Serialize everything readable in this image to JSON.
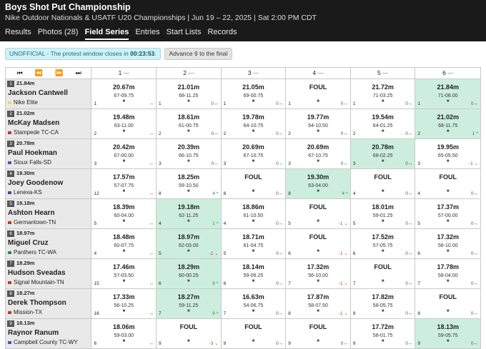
{
  "header": {
    "title": "Boys Shot Put Championship",
    "subtitle": "Nike Outdoor Nationals & USATF U20 Championships | Jun 19 – 22, 2025 | Sat 2:00 PM CDT",
    "tabs": [
      "Results",
      "Photos (28)",
      "Field Series",
      "Entries",
      "Start Lists",
      "Records"
    ],
    "active_tab": "Field Series"
  },
  "status": {
    "prefix": "UNOFFICIAL  -  The protest window closes in",
    "countdown": "00:23:53",
    "suffix": ".",
    "advance_label": "Advance 9 to the final"
  },
  "nav": {
    "first": "⏮",
    "prev": "⏪",
    "next": "⏩",
    "last": "⏭"
  },
  "attempt_headers": [
    "1",
    "2",
    "3",
    "4",
    "5",
    "6"
  ],
  "colors": {
    "highlight": "#cdeede",
    "header_bg": "#1a1a1a",
    "wind_up": "#2a8a56",
    "wind_down": "#c0392b"
  },
  "athletes": [
    {
      "place": "1",
      "best": "21.84m",
      "name": "Jackson Cantwell",
      "team": "Nike Elite",
      "flag_color": "#f5d36a",
      "attempts": [
        {
          "mark": "20.67m",
          "imperial": "67-09.75",
          "order": "1",
          "wind": "↔",
          "hi": false
        },
        {
          "mark": "21.01m",
          "imperial": "68-11.25",
          "order": "1",
          "wind": "0↔",
          "hi": false
        },
        {
          "mark": "21.05m",
          "imperial": "69-00.75",
          "order": "1",
          "wind": "0↔",
          "hi": false
        },
        {
          "mark": "FOUL",
          "imperial": "",
          "order": "1",
          "wind": "0↔",
          "hi": false
        },
        {
          "mark": "21.72m",
          "imperial": "71-03.25",
          "order": "1",
          "wind": "0↔",
          "hi": false
        },
        {
          "mark": "21.84m",
          "imperial": "71-08.00",
          "order": "1",
          "wind": "0↔",
          "hi": true
        }
      ]
    },
    {
      "place": "2",
      "best": "21.02m",
      "name": "McKay Madsen",
      "team": "Stampede TC-CA",
      "flag_color": "#c0392b",
      "attempts": [
        {
          "mark": "19.48m",
          "imperial": "63-11.00",
          "order": "2",
          "wind": "↔",
          "hi": false
        },
        {
          "mark": "18.61m",
          "imperial": "61-00.75",
          "order": "2",
          "wind": "0↔",
          "hi": false
        },
        {
          "mark": "19.78m",
          "imperial": "64-10.75",
          "order": "2",
          "wind": "0↔",
          "hi": false
        },
        {
          "mark": "19.77m",
          "imperial": "64-10.50",
          "order": "2",
          "wind": "0↔",
          "hi": false
        },
        {
          "mark": "19.54m",
          "imperial": "64-01.25",
          "order": "2",
          "wind": "0↔",
          "hi": false
        },
        {
          "mark": "21.02m",
          "imperial": "68-11.75",
          "order": "2",
          "wind": "1 ^",
          "hi": true
        }
      ]
    },
    {
      "place": "3",
      "best": "20.78m",
      "name": "Paul Hoekman",
      "team": "Sioux Falls-SD",
      "flag_color": "#3b5bb5",
      "attempts": [
        {
          "mark": "20.42m",
          "imperial": "67-00.00",
          "order": "3",
          "wind": "↔",
          "hi": false
        },
        {
          "mark": "20.39m",
          "imperial": "66-10.75",
          "order": "3",
          "wind": "0↔",
          "hi": false
        },
        {
          "mark": "20.69m",
          "imperial": "67-10.75",
          "order": "3",
          "wind": "0↔",
          "hi": false
        },
        {
          "mark": "20.69m",
          "imperial": "67-10.75",
          "order": "3",
          "wind": "0↔",
          "hi": false
        },
        {
          "mark": "20.78m",
          "imperial": "68-02.25",
          "order": "3",
          "wind": "0↔",
          "hi": true
        },
        {
          "mark": "19.95m",
          "imperial": "65-05.50",
          "order": "3",
          "wind": "-1 ⌄",
          "hi": false
        }
      ]
    },
    {
      "place": "4",
      "best": "19.30m",
      "name": "Joey Goodenow",
      "team": "Lenexa-KS",
      "flag_color": "#5a3f9b",
      "attempts": [
        {
          "mark": "17.57m",
          "imperial": "57-07.75",
          "order": "12",
          "wind": "↔",
          "hi": false
        },
        {
          "mark": "18.25m",
          "imperial": "59-10.50",
          "order": "8",
          "wind": "4 ^",
          "hi": false
        },
        {
          "mark": "FOUL",
          "imperial": "",
          "order": "8",
          "wind": "0↔",
          "hi": false
        },
        {
          "mark": "19.30m",
          "imperial": "63-04.00",
          "order": "8",
          "wind": "4 ^",
          "hi": true
        },
        {
          "mark": "FOUL",
          "imperial": "",
          "order": "4",
          "wind": "0↔",
          "hi": false
        },
        {
          "mark": "FOUL",
          "imperial": "",
          "order": "4",
          "wind": "0↔",
          "hi": false
        }
      ]
    },
    {
      "place": "5",
      "best": "19.18m",
      "name": "Ashton Hearn",
      "team": "Germantown-TN",
      "flag_color": "#c0392b",
      "attempts": [
        {
          "mark": "18.39m",
          "imperial": "60-04.00",
          "order": "5",
          "wind": "↔",
          "hi": false
        },
        {
          "mark": "19.18m",
          "imperial": "62-11.25",
          "order": "4",
          "wind": "1 ^",
          "hi": true
        },
        {
          "mark": "18.86m",
          "imperial": "61-10.50",
          "order": "4",
          "wind": "0↔",
          "hi": false
        },
        {
          "mark": "FOUL",
          "imperial": "",
          "order": "5",
          "wind": "-1 ⌄",
          "hi": false
        },
        {
          "mark": "18.01m",
          "imperial": "59-01.25",
          "order": "5",
          "wind": "0↔",
          "hi": false
        },
        {
          "mark": "17.37m",
          "imperial": "57-00.00",
          "order": "5",
          "wind": "0↔",
          "hi": false
        }
      ]
    },
    {
      "place": "6",
      "best": "18.97m",
      "name": "Miguel Cruz",
      "team": "Panthers TC-WA",
      "flag_color": "#2a8a56",
      "attempts": [
        {
          "mark": "18.48m",
          "imperial": "60-07.75",
          "order": "4",
          "wind": "↔",
          "hi": false
        },
        {
          "mark": "18.97m",
          "imperial": "62-03.00",
          "order": "5",
          "wind": "-1 ⌄",
          "hi": true
        },
        {
          "mark": "18.71m",
          "imperial": "61-04.75",
          "order": "5",
          "wind": "0↔",
          "hi": false
        },
        {
          "mark": "FOUL",
          "imperial": "",
          "order": "6",
          "wind": "-1 ⌄",
          "hi": false
        },
        {
          "mark": "17.52m",
          "imperial": "57-05.75",
          "order": "6",
          "wind": "0↔",
          "hi": false
        },
        {
          "mark": "17.32m",
          "imperial": "56-10.00",
          "order": "6",
          "wind": "0↔",
          "hi": false
        }
      ]
    },
    {
      "place": "7",
      "best": "18.29m",
      "name": "Hudson Sveadas",
      "team": "Signal Mountain-TN",
      "flag_color": "#c0392b",
      "attempts": [
        {
          "mark": "17.46m",
          "imperial": "57-03.50",
          "order": "15",
          "wind": "↔",
          "hi": false
        },
        {
          "mark": "18.29m",
          "imperial": "60-00.25",
          "order": "6",
          "wind": "9 ^",
          "hi": true
        },
        {
          "mark": "18.14m",
          "imperial": "59-06.25",
          "order": "6",
          "wind": "0↔",
          "hi": false
        },
        {
          "mark": "17.32m",
          "imperial": "56-10.00",
          "order": "7",
          "wind": "-1 ⌄",
          "hi": false
        },
        {
          "mark": "FOUL",
          "imperial": "",
          "order": "7",
          "wind": "0↔",
          "hi": false
        },
        {
          "mark": "17.78m",
          "imperial": "58-04.00",
          "order": "7",
          "wind": "0↔",
          "hi": false
        }
      ]
    },
    {
      "place": "8",
      "best": "18.27m",
      "name": "Derek Thompson",
      "team": "Mission-TX",
      "flag_color": "#c0392b",
      "attempts": [
        {
          "mark": "17.33m",
          "imperial": "56-10.25",
          "order": "16",
          "wind": "↔",
          "hi": false
        },
        {
          "mark": "18.27m",
          "imperial": "59-11.25",
          "order": "7",
          "wind": "9 ^",
          "hi": true
        },
        {
          "mark": "16.63m",
          "imperial": "54-06.75",
          "order": "7",
          "wind": "0↔",
          "hi": false
        },
        {
          "mark": "17.87m",
          "imperial": "58-07.50",
          "order": "8",
          "wind": "-1 ⌄",
          "hi": false
        },
        {
          "mark": "17.82m",
          "imperial": "58-05.75",
          "order": "8",
          "wind": "0↔",
          "hi": false
        },
        {
          "mark": "FOUL",
          "imperial": "",
          "order": "8",
          "wind": "0↔",
          "hi": false
        }
      ]
    },
    {
      "place": "9",
      "best": "18.13m",
      "name": "Raynor Ranum",
      "team": "Campbell County TC-WY",
      "flag_color": "#3b5bb5",
      "attempts": [
        {
          "mark": "18.06m",
          "imperial": "59-03.00",
          "order": "6",
          "wind": "↔",
          "hi": false
        },
        {
          "mark": "FOUL",
          "imperial": "",
          "order": "9",
          "wind": "-3 ⌄",
          "hi": false
        },
        {
          "mark": "FOUL",
          "imperial": "",
          "order": "9",
          "wind": "0↔",
          "hi": false
        },
        {
          "mark": "FOUL",
          "imperial": "",
          "order": "9",
          "wind": "0↔",
          "hi": false
        },
        {
          "mark": "17.72m",
          "imperial": "58-01.75",
          "order": "9",
          "wind": "0↔",
          "hi": false
        },
        {
          "mark": "18.13m",
          "imperial": "59-05.75",
          "order": "9",
          "wind": "0↔",
          "hi": true
        }
      ]
    }
  ]
}
